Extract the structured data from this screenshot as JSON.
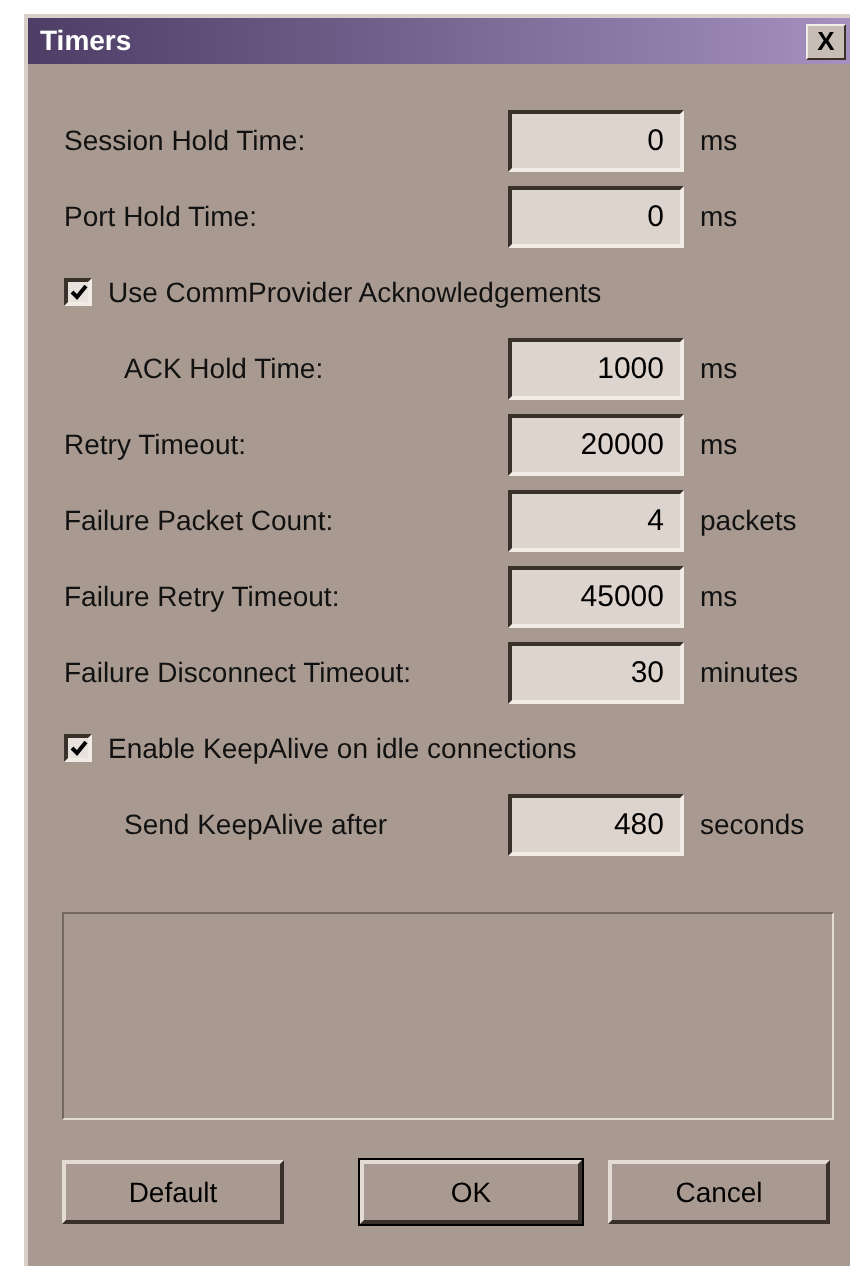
{
  "window": {
    "title": "Timers",
    "close": "X"
  },
  "settings": [
    {
      "kind": "field",
      "label": "Session Hold Time:",
      "value": "0",
      "unit": "ms"
    },
    {
      "kind": "field",
      "label": "Port Hold Time:",
      "value": "0",
      "unit": "ms"
    },
    {
      "kind": "checkbox",
      "label": "Use CommProvider Acknowledgements",
      "checked": true,
      "children": [
        {
          "kind": "field",
          "label": "ACK Hold Time:",
          "value": "1000",
          "unit": "ms"
        }
      ]
    },
    {
      "kind": "field",
      "label": "Retry Timeout:",
      "value": "20000",
      "unit": "ms"
    },
    {
      "kind": "field",
      "label": "Failure Packet Count:",
      "value": "4",
      "unit": "packets"
    },
    {
      "kind": "field",
      "label": "Failure Retry Timeout:",
      "value": "45000",
      "unit": "ms"
    },
    {
      "kind": "field",
      "label": "Failure Disconnect Timeout:",
      "value": "30",
      "unit": "minutes"
    },
    {
      "kind": "checkbox",
      "label": "Enable KeepAlive on idle connections",
      "checked": true,
      "children": [
        {
          "kind": "field",
          "label": "Send KeepAlive after",
          "value": "480",
          "unit": "seconds"
        }
      ]
    }
  ],
  "buttons": [
    {
      "label": "Default",
      "default": false
    },
    {
      "label": "OK",
      "default": true
    },
    {
      "label": "Cancel",
      "default": false
    }
  ]
}
